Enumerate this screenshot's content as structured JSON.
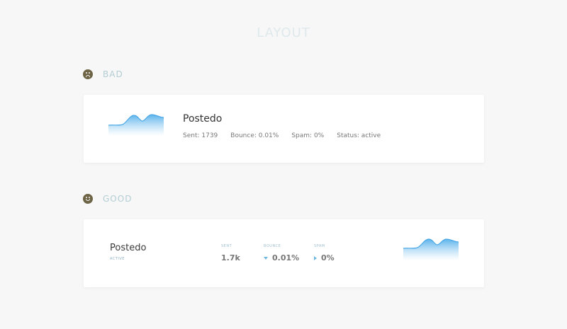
{
  "page": {
    "title": "LAYOUT"
  },
  "sections": {
    "bad": {
      "label": "BAD",
      "icon": "sad-face-icon",
      "card": {
        "name": "Postedo",
        "stats": {
          "sent": "Sent: 1739",
          "bounce": "Bounce: 0.01%",
          "spam": "Spam: 0%",
          "status": "Status: active"
        }
      }
    },
    "good": {
      "label": "GOOD",
      "icon": "happy-face-icon",
      "card": {
        "name": "Postedo",
        "status": "ACTIVE",
        "metrics": [
          {
            "label": "SENT",
            "value": "1.7k",
            "icon": ""
          },
          {
            "label": "BOUNCE",
            "value": "0.01%",
            "icon": "arrow-down-icon"
          },
          {
            "label": "SPAM",
            "value": "0%",
            "icon": "arrow-right-icon"
          }
        ]
      }
    }
  },
  "colors": {
    "accent": "#6fb6e0",
    "face": "#6d6446",
    "label": "#b3cdd4"
  }
}
